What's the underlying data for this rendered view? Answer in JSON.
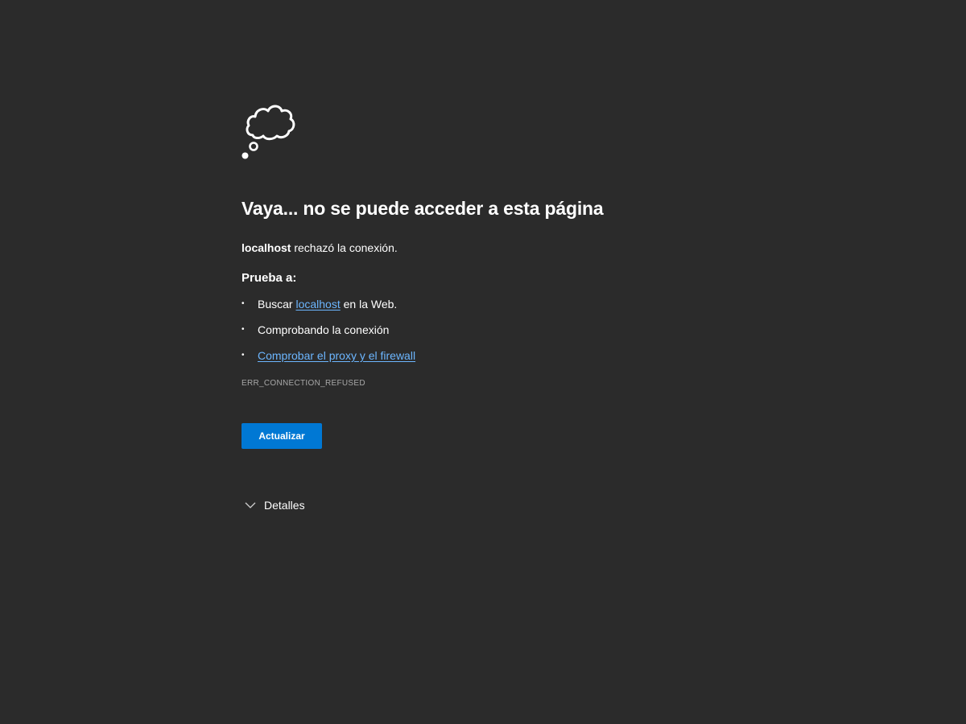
{
  "error_page": {
    "icon": "thought-cloud-icon",
    "title": "Vaya... no se puede acceder a esta página",
    "host": "localhost",
    "description_suffix": " rechazó la conexión.",
    "try_heading": "Prueba a:",
    "suggestions": {
      "search_prefix": "Buscar ",
      "search_link": "localhost",
      "search_suffix": " en la Web.",
      "check_connection": "Comprobando la conexión",
      "check_proxy_link": "Comprobar el proxy y el firewall"
    },
    "error_code": "ERR_CONNECTION_REFUSED",
    "refresh_label": "Actualizar",
    "details_label": "Detalles",
    "details_icon": "chevron-down-icon",
    "bullet": "•"
  }
}
